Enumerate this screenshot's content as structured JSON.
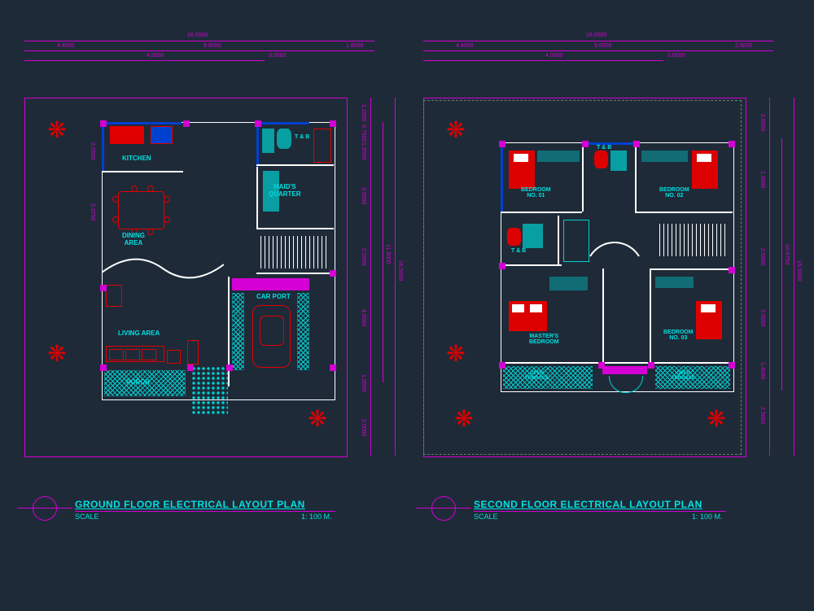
{
  "titles": {
    "ground": "GROUND FLOOR  ELECTRICAL LAYOUT PLAN",
    "second": "SECOND FLOOR ELECTRICAL LAYOUT PLAN",
    "scale_label": "SCALE",
    "scale_value": "1: 100 M."
  },
  "dims": {
    "ground_top_total": "16.0000",
    "ground_top_left": "4.4000",
    "ground_top_mid": "9.8000",
    "ground_top_seg1": "4.0000",
    "ground_top_seg2": "3.0000",
    "ground_top_right": "1.8000",
    "ground_right_total": "16.5000",
    "ground_right_inner": "11.5000",
    "ground_r1": "1.2500",
    "ground_r2": "0.7500",
    "ground_r3": "1.5000",
    "ground_r4": "3.5000",
    "ground_r5": "2.0000",
    "ground_r6": "4.0000",
    "ground_r7": "1.5000",
    "ground_r8": "2.0000",
    "ground_left1": "2.0500",
    "ground_left2": "3.3750",
    "second_top_total": "16.0000",
    "second_top_left": "4.4000",
    "second_top_mid": "9.0000",
    "second_top_seg1": "4.0000",
    "second_top_seg2": "3.0000",
    "second_top_right": "2.6000",
    "second_right_total": "15.5000",
    "second_right_inner": "10.9750",
    "second_r1": "2.0000",
    "second_r2": "1.9000",
    "second_r3": "2.0000",
    "second_r4": "3.5000",
    "second_r5": "1.4000",
    "second_r6": "2.5000"
  },
  "rooms": {
    "kitchen": "KITCHEN",
    "dining": "DINING\nAREA",
    "tb": "T & B",
    "maids": "MAID'S\nQUARTER",
    "living": "LIVING AREA",
    "carport": "CAR PORT",
    "porch": "PORCH",
    "bedroom1": "BEDROOM\nNO. 01",
    "bedroom2": "BEDROOM\nNO. 02",
    "bedroom3": "BEDROOM\nNO. 03",
    "masters": "MASTER'S\nBEDROOM",
    "open_terrace": "OPEN\nTERRACE"
  }
}
